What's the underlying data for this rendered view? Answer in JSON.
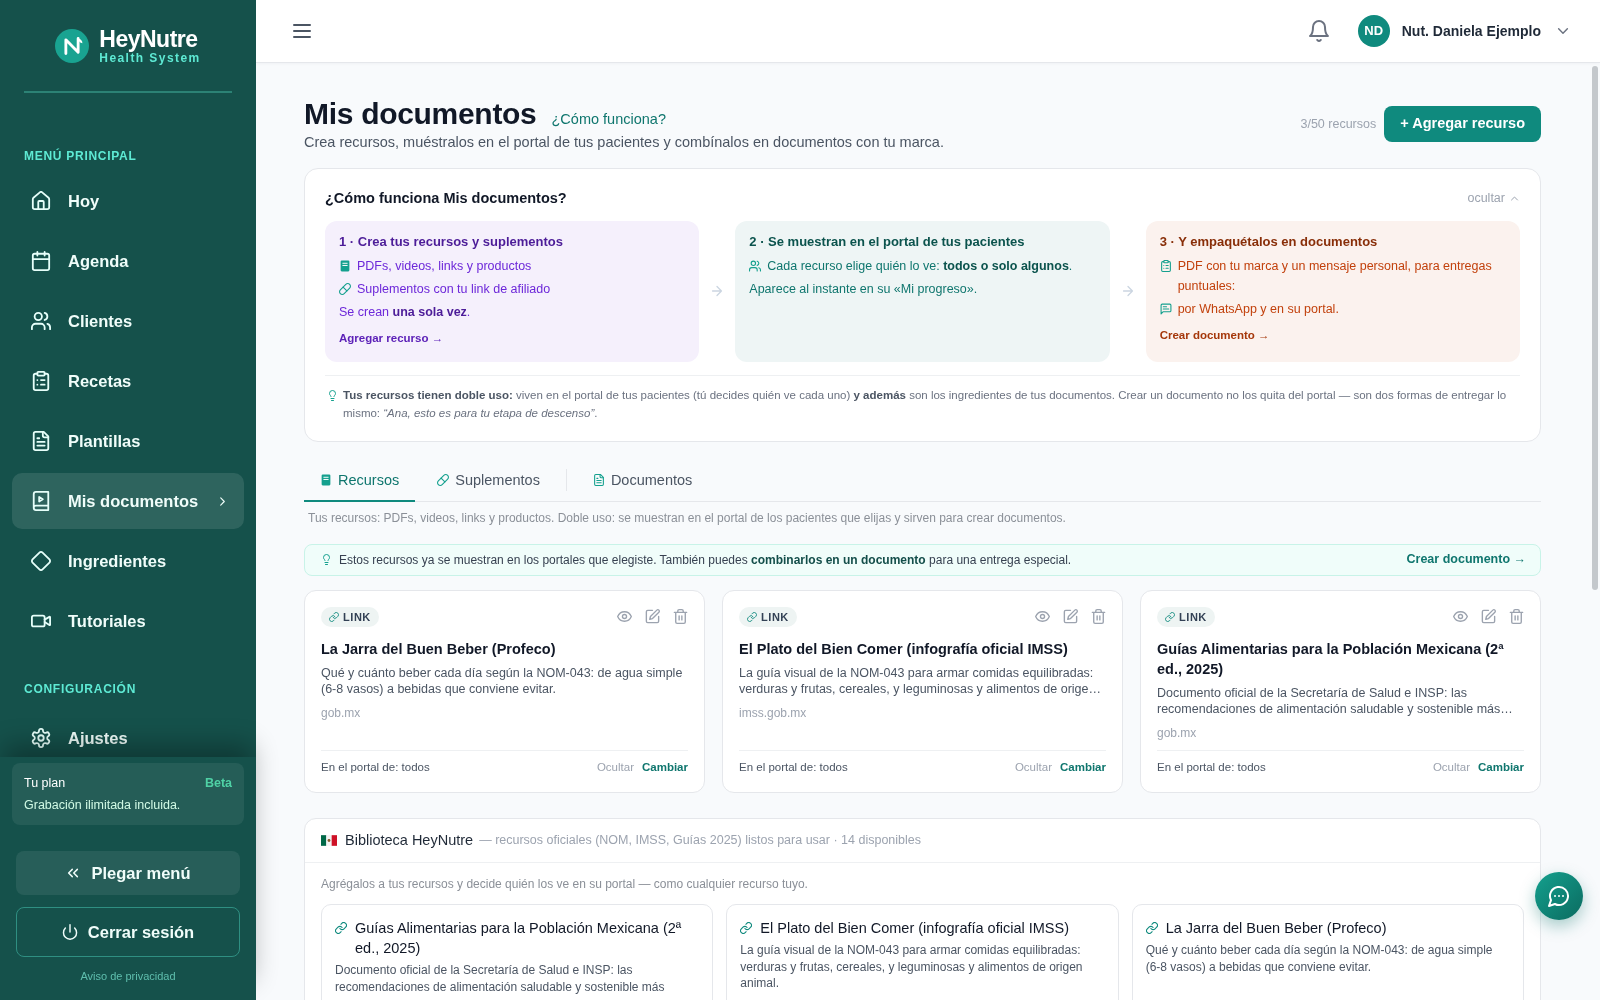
{
  "sidebar": {
    "brand": {
      "name": "HeyNutre",
      "tagline": "Health System"
    },
    "sections": [
      {
        "title": "MENÚ PRINCIPAL",
        "items": [
          {
            "label": "Hoy",
            "selected": false
          },
          {
            "label": "Agenda",
            "selected": false
          },
          {
            "label": "Clientes",
            "selected": false
          },
          {
            "label": "Recetas",
            "selected": false
          },
          {
            "label": "Plantillas",
            "selected": false
          },
          {
            "label": "Mis documentos",
            "selected": true
          },
          {
            "label": "Ingredientes",
            "selected": false
          },
          {
            "label": "Tutoriales",
            "selected": false
          }
        ]
      },
      {
        "title": "CONFIGURACIÓN",
        "items": [
          {
            "label": "Ajustes",
            "selected": false
          }
        ]
      }
    ],
    "plan": {
      "title": "Tu plan",
      "badge": "Beta",
      "text": "Grabación ilimitada incluida."
    },
    "collapse_button": "Plegar menú",
    "logout_button": "Cerrar sesión",
    "privacy_link": "Aviso de privacidad"
  },
  "header": {
    "user": {
      "initials": "ND",
      "name": "Nut. Daniela Ejemplo"
    }
  },
  "page": {
    "title": "Mis documentos",
    "help_link": "¿Cómo funciona?",
    "subtitle": "Crea recursos, muéstralos en el portal de tus pacientes y combínalos en documentos con tu marca.",
    "quota": "3/50 recursos",
    "add_button": "+ Agregar recurso"
  },
  "how_it_works": {
    "title": "¿Cómo funciona Mis documentos?",
    "toggle": "ocultar",
    "steps": [
      {
        "title": "1 · Crea tus recursos y suplementos",
        "color": "#6d28d9",
        "lines": [
          {
            "kind": "bullet",
            "text": "PDFs, videos, links y productos"
          },
          {
            "kind": "bullet",
            "text": "Suplementos con tu link de afiliado"
          },
          {
            "kind": "plain",
            "text": "Se crean **una sola vez**."
          }
        ],
        "link": "Agregar recurso →"
      },
      {
        "title": "2 · Se muestran en el portal de tus pacientes",
        "color": "#0f766e",
        "lines": [
          {
            "kind": "bullet",
            "text": "Cada recurso elige quién lo ve: **todos o solo algunos**."
          },
          {
            "kind": "plain",
            "text": "Aparece al instante en su «Mi progreso»."
          }
        ]
      },
      {
        "title": "3 · Y empaquétalos en documentos",
        "color": "#c2410c",
        "lines": [
          {
            "kind": "bullet",
            "text": "PDF con tu marca y un mensaje personal, para entregas puntuales:"
          },
          {
            "kind": "bullet",
            "text": "por WhatsApp y en su portal."
          }
        ],
        "link": "Crear documento →"
      }
    ],
    "note": "**Tus recursos tienen doble uso:** viven en el portal de tus pacientes (tú decides quién ve cada uno) **y además** son los ingredientes de tus documentos. Crear un documento no los quita del portal — son dos formas de entregar lo mismo: *“Ana, esto es para tu etapa de descenso”*."
  },
  "tabs": [
    {
      "label": "Recursos",
      "selected": true
    },
    {
      "label": "Suplementos",
      "selected": false
    },
    {
      "label": "Documentos",
      "selected": false
    }
  ],
  "tab_description": "Tus recursos: PDFs, videos, links y productos. Doble uso: se muestran en el portal de los pacientes que elijas y sirven para crear documentos.",
  "notice": {
    "text": "Estos recursos ya se muestran en los portales que elegiste. También puedes **combinarlos en un documento** para una entrega especial.",
    "link": "Crear documento →"
  },
  "resources": [
    {
      "type": "LINK",
      "title": "La Jarra del Buen Beber (Profeco)",
      "description": "Qué y cuánto beber cada día según la NOM-043: de agua simple (6-8 vasos) a bebidas que conviene evitar.",
      "source": "gob.mx",
      "visibility": "En el portal de: todos",
      "hide": "Ocultar",
      "change": "Cambiar"
    },
    {
      "type": "LINK",
      "title": "El Plato del Bien Comer (infografía oficial IMSS)",
      "description": "La guía visual de la NOM-043 para armar comidas equilibradas: verduras y frutas, cereales, y leguminosas y alimentos de orige…",
      "source": "imss.gob.mx",
      "visibility": "En el portal de: todos",
      "hide": "Ocultar",
      "change": "Cambiar"
    },
    {
      "type": "LINK",
      "title": "Guías Alimentarias para la Población Mexicana (2ª ed., 2025)",
      "description": "Documento oficial de la Secretaría de Salud e INSP: las recomendaciones de alimentación saludable y sostenible más…",
      "source": "gob.mx",
      "visibility": "En el portal de: todos",
      "hide": "Ocultar",
      "change": "Cambiar"
    }
  ],
  "library": {
    "title": "Biblioteca HeyNutre",
    "meta": "— recursos oficiales (NOM, IMSS, Guías 2025) listos para usar · 14 disponibles",
    "description": "Agrégalos a tus recursos y decide quién los ve en su portal — como cualquier recurso tuyo.",
    "items": [
      {
        "title": "Guías Alimentarias para la Población Mexicana (2ª ed., 2025)",
        "description": "Documento oficial de la Secretaría de Salud e INSP: las recomendaciones de alimentación saludable y sostenible más"
      },
      {
        "title": "El Plato del Bien Comer (infografía oficial IMSS)",
        "description": "La guía visual de la NOM-043 para armar comidas equilibradas: verduras y frutas, cereales, y leguminosas y alimentos de origen animal."
      },
      {
        "title": "La Jarra del Buen Beber (Profeco)",
        "description": "Qué y cuánto beber cada día según la NOM-043: de agua simple (6-8 vasos) a bebidas que conviene evitar."
      }
    ]
  }
}
